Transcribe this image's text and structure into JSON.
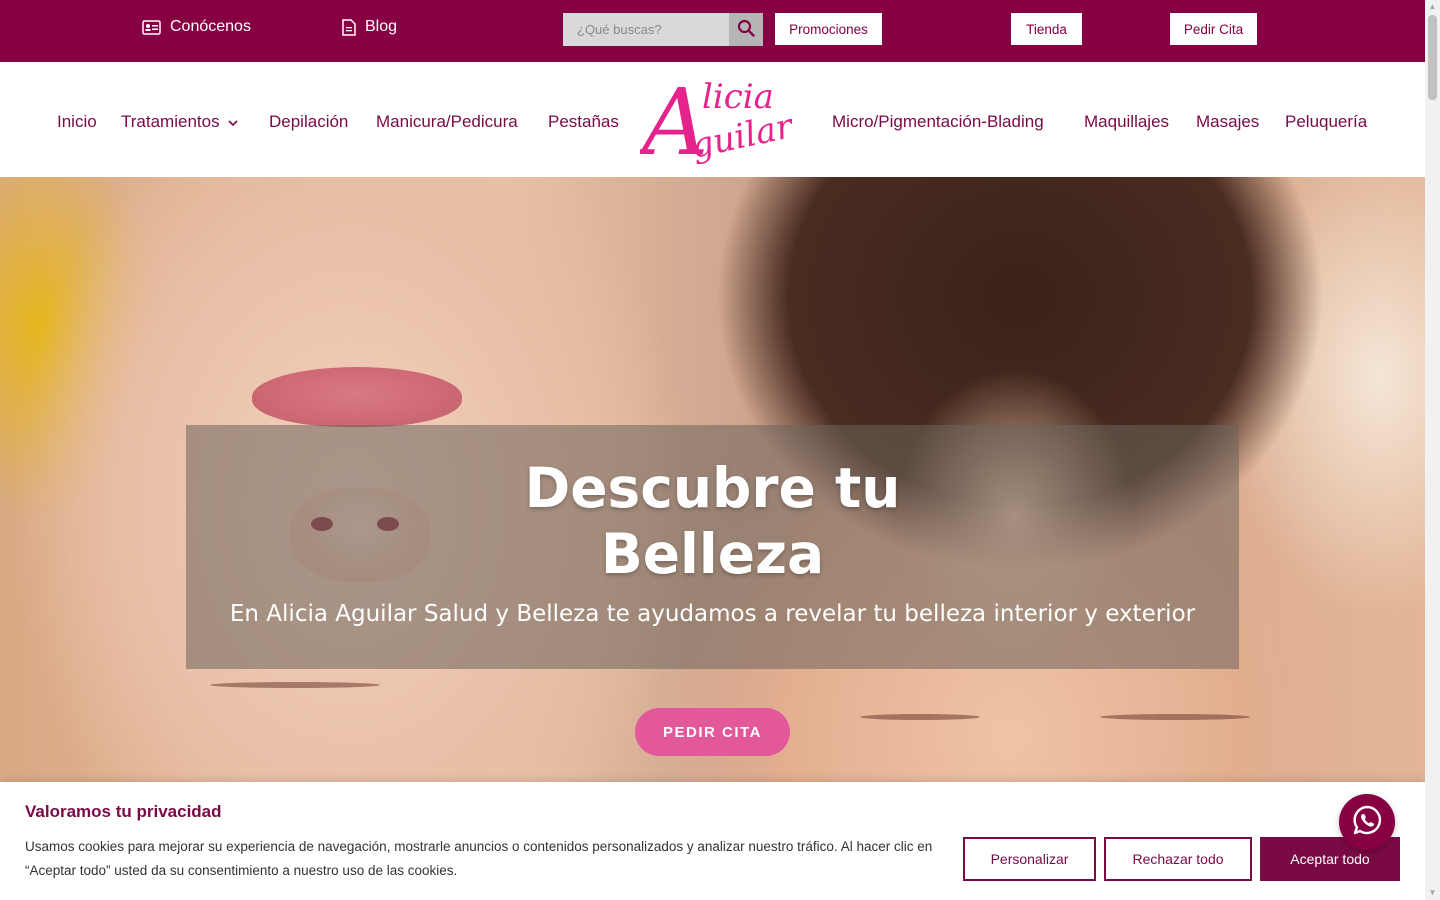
{
  "topbar": {
    "conocenos": "Conócenos",
    "blog": "Blog",
    "search_placeholder": "¿Qué buscas?",
    "promociones": "Promociones",
    "tienda": "Tienda",
    "pedir_cita": "Pedir Cita"
  },
  "nav": {
    "items": [
      "Inicio",
      "Tratamientos",
      "Depilación",
      "Manicura/Pedicura",
      "Pestañas",
      "Micro/Pigmentación-Blading",
      "Maquillajes",
      "Masajes",
      "Peluquería"
    ],
    "logo_text": "Alicia Aguilar"
  },
  "hero": {
    "title_line1": "Descubre tu",
    "title_line2": "Belleza",
    "subtitle": "En Alicia Aguilar Salud y Belleza te ayudamos a revelar tu belleza interior y exterior",
    "cta": "PEDIR CITA"
  },
  "cookie": {
    "title": "Valoramos tu privacidad",
    "text": "Usamos cookies para mejorar su experiencia de navegación, mostrarle anuncios o contenidos personalizados y analizar nuestro tráfico. Al hacer clic en “Aceptar todo” usted da su consentimiento a nuestro uso de las cookies.",
    "personalizar": "Personalizar",
    "rechazar": "Rechazar todo",
    "aceptar": "Aceptar todo"
  },
  "colors": {
    "brand": "#880044",
    "nav_text": "#7a0a45",
    "cta_pink": "#e2589a",
    "logo_pink": "#e6238c"
  },
  "icons": [
    "id-card-icon",
    "document-icon",
    "search-icon",
    "chevron-down-icon",
    "whatsapp-icon"
  ]
}
